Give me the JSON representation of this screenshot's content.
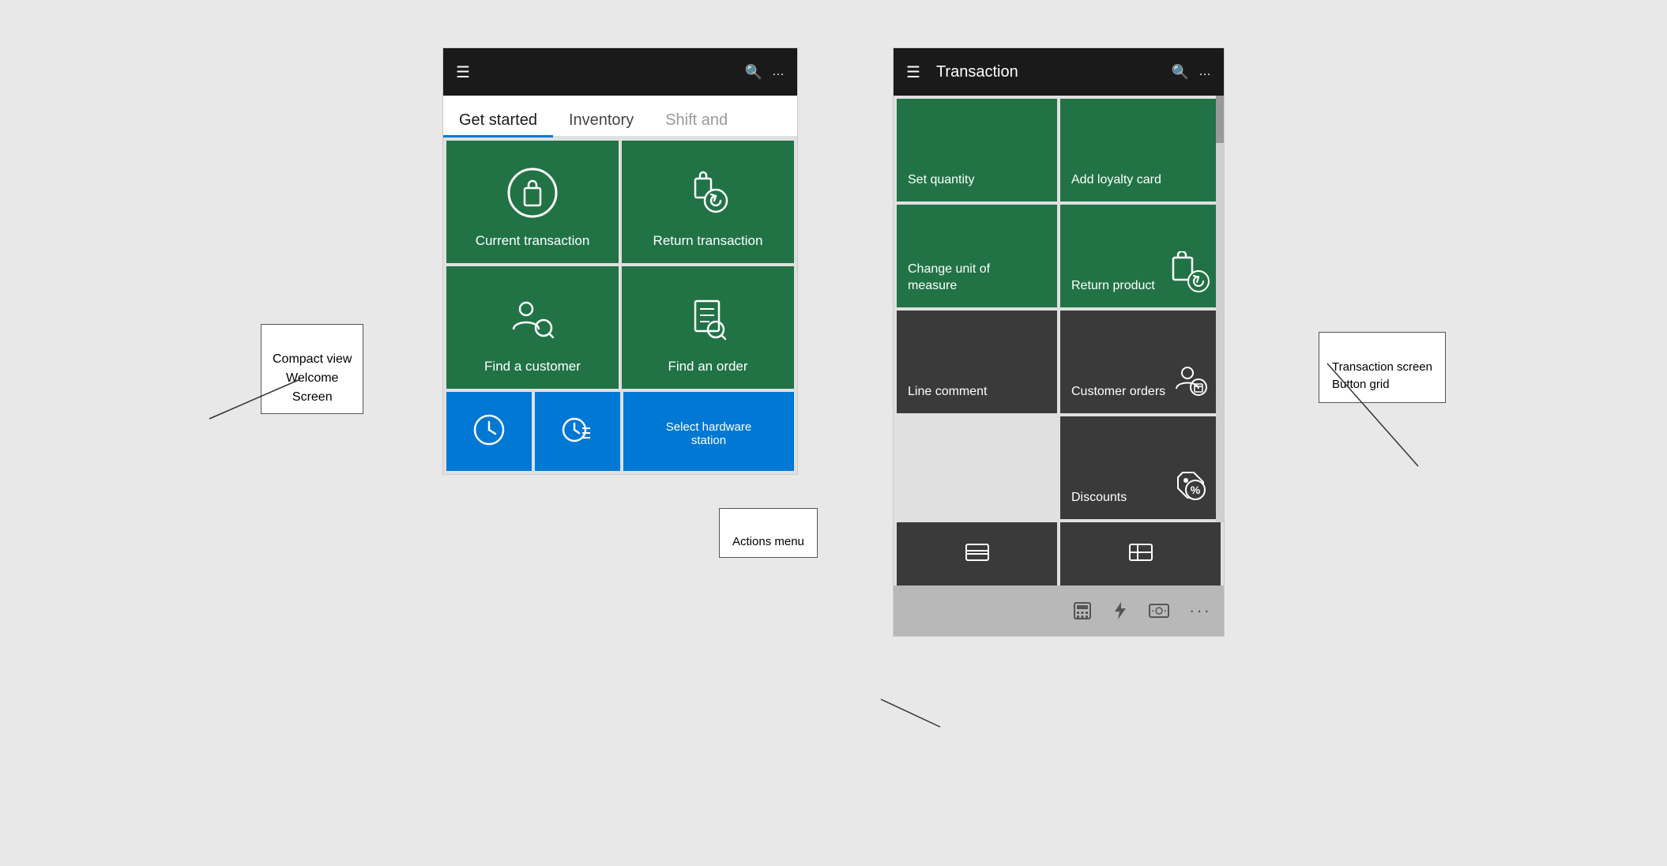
{
  "leftPhone": {
    "header": {
      "hamburgerLabel": "☰",
      "searchLabel": "🔍",
      "moreLabel": "…"
    },
    "tabs": [
      {
        "label": "Get started",
        "active": true
      },
      {
        "label": "Inventory",
        "active": false
      },
      {
        "label": "Shift and",
        "active": false,
        "faded": true
      }
    ],
    "gridButtons": [
      {
        "id": "current-transaction",
        "label": "Current transaction",
        "color": "green"
      },
      {
        "id": "return-transaction",
        "label": "Return transaction",
        "color": "green"
      },
      {
        "id": "find-customer",
        "label": "Find a customer",
        "color": "green"
      },
      {
        "id": "find-order",
        "label": "Find an order",
        "color": "green"
      }
    ],
    "bottomButtons": [
      {
        "id": "clock-btn",
        "label": "",
        "color": "blue"
      },
      {
        "id": "clock-list-btn",
        "label": "",
        "color": "blue"
      },
      {
        "id": "hardware-station-btn",
        "label": "Select hardware\nstation",
        "color": "blue"
      }
    ],
    "callout": {
      "text": "Compact view\nWelcome\nScreen"
    }
  },
  "rightPhone": {
    "header": {
      "hamburgerLabel": "☰",
      "title": "Transaction",
      "searchLabel": "🔍",
      "moreLabel": "…"
    },
    "gridButtons": [
      {
        "id": "set-quantity",
        "label": "Set quantity",
        "color": "green"
      },
      {
        "id": "add-loyalty",
        "label": "Add loyalty card",
        "color": "green"
      },
      {
        "id": "change-uom",
        "label": "Change unit of\nmeasure",
        "color": "green"
      },
      {
        "id": "return-product",
        "label": "Return product",
        "color": "green"
      },
      {
        "id": "line-comment",
        "label": "Line comment",
        "color": "dark"
      },
      {
        "id": "customer-orders",
        "label": "Customer orders",
        "color": "dark"
      },
      {
        "id": "discounts",
        "label": "Discounts",
        "color": "dark"
      }
    ],
    "partialButtons": [
      {
        "id": "partial-left",
        "label": ""
      },
      {
        "id": "partial-right",
        "label": ""
      }
    ],
    "toolbar": {
      "buttons": [
        {
          "id": "calculator-btn",
          "label": "⊞"
        },
        {
          "id": "lightning-btn",
          "label": "⚡"
        },
        {
          "id": "money-btn",
          "label": "💵"
        },
        {
          "id": "more-btn",
          "label": "…"
        }
      ]
    },
    "callouts": {
      "transactionGrid": "Transaction screen\nButton grid",
      "actionsMenu": "Actions menu"
    }
  }
}
